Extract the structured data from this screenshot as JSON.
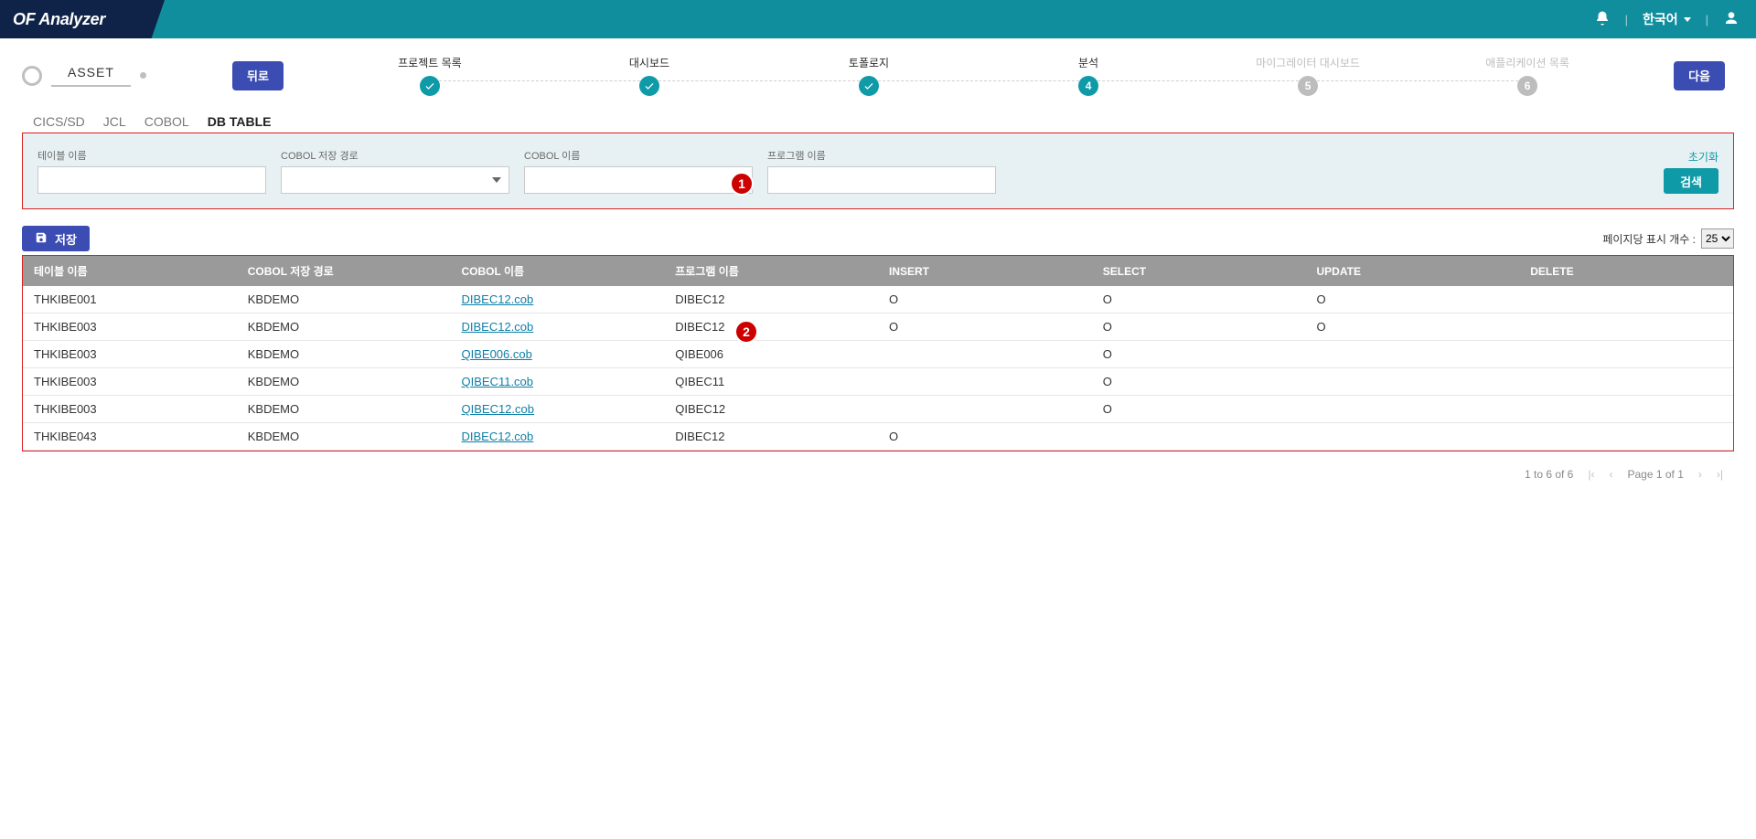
{
  "header": {
    "logo": "OF Analyzer",
    "language": "한국어"
  },
  "asset": {
    "label": "ASSET"
  },
  "buttons": {
    "back": "뒤로",
    "next": "다음",
    "save": "저장",
    "search": "검색",
    "reset": "초기화"
  },
  "steps": [
    {
      "label": "프로젝트 목록",
      "state": "done"
    },
    {
      "label": "대시보드",
      "state": "done"
    },
    {
      "label": "토폴로지",
      "state": "done"
    },
    {
      "label": "분석",
      "state": "current",
      "num": "4"
    },
    {
      "label": "마이그레이터 대시보드",
      "state": "pending",
      "num": "5"
    },
    {
      "label": "애플리케이션 목록",
      "state": "pending",
      "num": "6"
    }
  ],
  "tabs": [
    {
      "label": "CICS/SD",
      "active": false
    },
    {
      "label": "JCL",
      "active": false
    },
    {
      "label": "COBOL",
      "active": false
    },
    {
      "label": "DB TABLE",
      "active": true
    }
  ],
  "search": {
    "table_name_label": "테이블 이름",
    "cobol_path_label": "COBOL 저장 경로",
    "cobol_name_label": "COBOL 이름",
    "program_name_label": "프로그램 이름",
    "callout": "1"
  },
  "pagesize": {
    "label": "페이지당 표시 개수 :",
    "value": "25"
  },
  "table": {
    "callout": "2",
    "headers": {
      "table_name": "테이블 이름",
      "cobol_path": "COBOL 저장 경로",
      "cobol_name": "COBOL 이름",
      "program_name": "프로그램 이름",
      "insert": "INSERT",
      "select": "SELECT",
      "update": "UPDATE",
      "delete": "DELETE"
    },
    "rows": [
      {
        "table_name": "THKIBE001",
        "cobol_path": "KBDEMO",
        "cobol_name": "DIBEC12.cob",
        "program_name": "DIBEC12",
        "insert": "O",
        "select": "O",
        "update": "O",
        "delete": ""
      },
      {
        "table_name": "THKIBE003",
        "cobol_path": "KBDEMO",
        "cobol_name": "DIBEC12.cob",
        "program_name": "DIBEC12",
        "insert": "O",
        "select": "O",
        "update": "O",
        "delete": ""
      },
      {
        "table_name": "THKIBE003",
        "cobol_path": "KBDEMO",
        "cobol_name": "QIBE006.cob",
        "program_name": "QIBE006",
        "insert": "",
        "select": "O",
        "update": "",
        "delete": ""
      },
      {
        "table_name": "THKIBE003",
        "cobol_path": "KBDEMO",
        "cobol_name": "QIBEC11.cob",
        "program_name": "QIBEC11",
        "insert": "",
        "select": "O",
        "update": "",
        "delete": ""
      },
      {
        "table_name": "THKIBE003",
        "cobol_path": "KBDEMO",
        "cobol_name": "QIBEC12.cob",
        "program_name": "QIBEC12",
        "insert": "",
        "select": "O",
        "update": "",
        "delete": ""
      },
      {
        "table_name": "THKIBE043",
        "cobol_path": "KBDEMO",
        "cobol_name": "DIBEC12.cob",
        "program_name": "DIBEC12",
        "insert": "O",
        "select": "",
        "update": "",
        "delete": ""
      }
    ]
  },
  "pagination": {
    "range": "1 to 6 of 6",
    "page_label": "Page 1 of 1"
  }
}
